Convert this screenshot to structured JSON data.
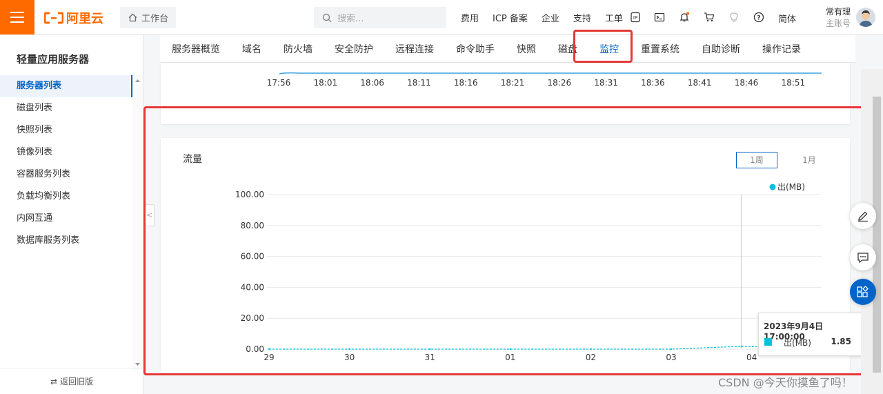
{
  "header": {
    "logo_text": "阿里云",
    "workbench_label": "工作台",
    "search_placeholder": "搜索...",
    "nav_links": [
      "费用",
      "ICP 备案",
      "企业",
      "支持",
      "工单"
    ],
    "language": "简体",
    "user_name": "常有理",
    "user_role": "主账号",
    "brand_color": "#ff6a00"
  },
  "sidebar": {
    "title": "轻量应用服务器",
    "items": [
      {
        "label": "服务器列表",
        "active": true
      },
      {
        "label": "磁盘列表"
      },
      {
        "label": "快照列表"
      },
      {
        "label": "镜像列表"
      },
      {
        "label": "容器服务列表"
      },
      {
        "label": "负载均衡列表"
      },
      {
        "label": "内网互通"
      },
      {
        "label": "数据库服务列表"
      }
    ],
    "footer_label": "返回旧版"
  },
  "tabs": {
    "items": [
      "服务器概览",
      "域名",
      "防火墙",
      "安全防护",
      "远程连接",
      "命令助手",
      "快照",
      "磁盘",
      "监控",
      "重置系统",
      "自助诊断",
      "操作记录"
    ],
    "active": "监控",
    "active_color": "#0064c8"
  },
  "upper_chart": {
    "x_ticks": [
      "17:56",
      "18:01",
      "18:06",
      "18:11",
      "18:16",
      "18:21",
      "18:26",
      "18:31",
      "18:36",
      "18:41",
      "18:46",
      "18:51"
    ]
  },
  "traffic_card": {
    "title": "流量",
    "range_options": [
      "1周",
      "1月"
    ],
    "range_selected": "1周"
  },
  "chart_data": {
    "type": "line",
    "title": "流量",
    "x": [
      "29",
      "30",
      "31",
      "01",
      "02",
      "03",
      "04"
    ],
    "series": [
      {
        "name": "出(MB)",
        "color": "#00c1de",
        "values": [
          0,
          0,
          0,
          0,
          0,
          0,
          1.85
        ]
      }
    ],
    "y_ticks": [
      "100.00",
      "80.00",
      "60.00",
      "40.00",
      "20.00",
      "0.00"
    ],
    "ylim": [
      0,
      100
    ],
    "grid": true,
    "legend_position": "top-right"
  },
  "tooltip": {
    "time": "2023年9月4日 17:00:00",
    "series_label": "出(MB)",
    "value": "1.85"
  },
  "watermark": "CSDN @今天你摸鱼了吗！"
}
